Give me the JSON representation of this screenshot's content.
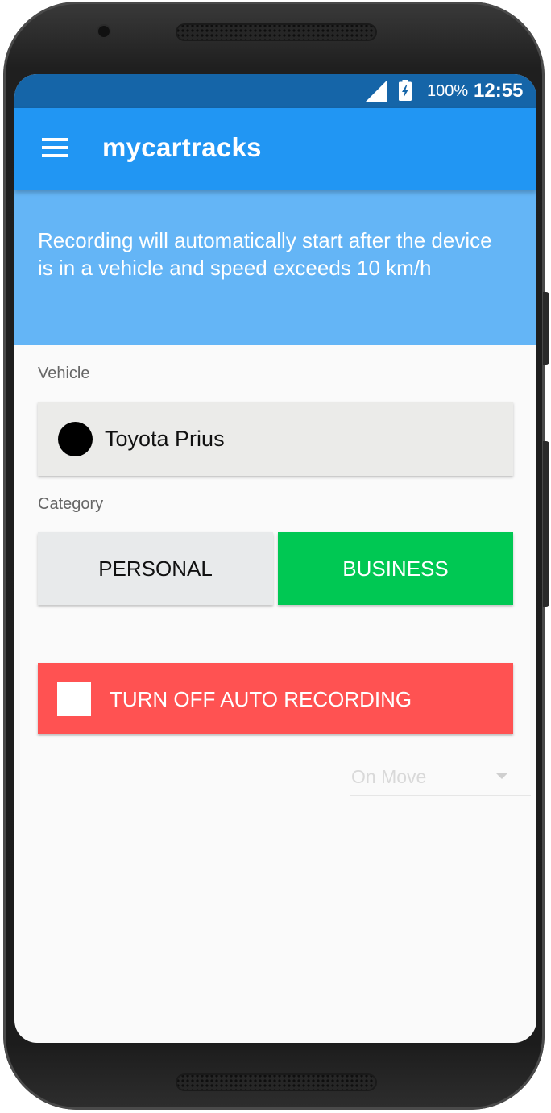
{
  "status_bar": {
    "battery_percent": "100%",
    "time": "12:55",
    "signal_icon": "signal-icon",
    "battery_icon": "battery-charging-icon"
  },
  "app_bar": {
    "title": "mycartracks",
    "menu_icon": "hamburger-menu-icon"
  },
  "info_banner": {
    "text": "Recording will automatically start after the device is in a vehicle and speed exceeds 10 km/h"
  },
  "vehicle": {
    "label": "Vehicle",
    "selected": "Toyota Prius",
    "color": "#000000"
  },
  "category": {
    "label": "Category",
    "options": [
      {
        "label": "PERSONAL",
        "selected": false
      },
      {
        "label": "BUSINESS",
        "selected": true
      }
    ]
  },
  "auto_recording": {
    "button_label": "TURN OFF AUTO RECORDING",
    "checked": false
  },
  "trigger": {
    "selected": "On Move"
  },
  "colors": {
    "status_bar": "#1565a8",
    "app_bar": "#2196f3",
    "banner": "#64b5f6",
    "business": "#00c853",
    "personal": "#e8eaeb",
    "auto_button": "#ff5252"
  }
}
